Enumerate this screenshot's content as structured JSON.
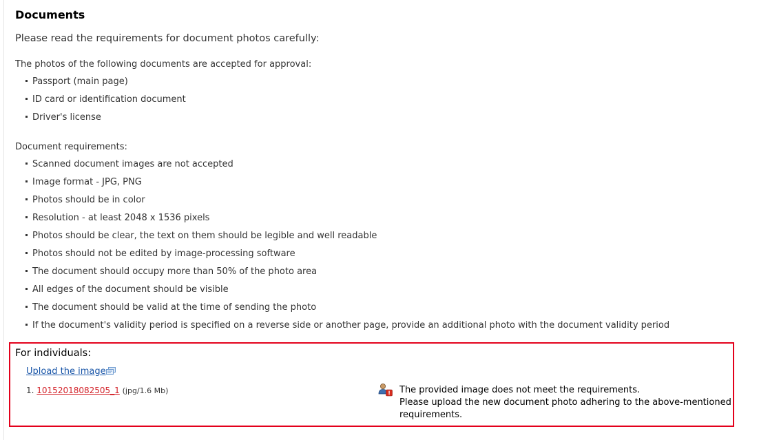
{
  "page": {
    "title": "Documents",
    "intro": "Please read the requirements for document photos carefully:"
  },
  "accepted": {
    "heading": "The photos of the following documents are accepted for approval:",
    "items": [
      "Passport (main page)",
      "ID card or identification document",
      "Driver's license"
    ]
  },
  "requirements": {
    "heading": "Document requirements:",
    "items": [
      "Scanned document images are not accepted",
      "Image format - JPG, PNG",
      "Photos should be in color",
      "Resolution - at least 2048 x 1536 pixels",
      "Photos should be clear, the text on them should be legible and well readable",
      "Photos should not be edited by image-processing software",
      "The document should occupy more than 50% of the photo area",
      "All edges of the document should be visible",
      "The document should be valid at the time of sending the photo",
      "If the document's validity period is specified on a reverse side or another page, provide an additional photo with the document validity period"
    ]
  },
  "individuals": {
    "title": "For individuals:",
    "upload_label": "Upload the image",
    "upload_icon": "upload-image-icon",
    "files": [
      {
        "index": "1.",
        "name": "10152018082505_1",
        "meta": "(jpg/1.6 Mb)"
      }
    ],
    "warning_icon": "user-warning-icon",
    "warning_lines": [
      "The provided image does not meet the requirements.",
      "Please upload the new document photo adhering to the above-mentioned",
      "requirements."
    ]
  },
  "colors": {
    "highlight_border": "#e3001b",
    "link": "#1a56a8",
    "file_link": "#d21f26"
  }
}
